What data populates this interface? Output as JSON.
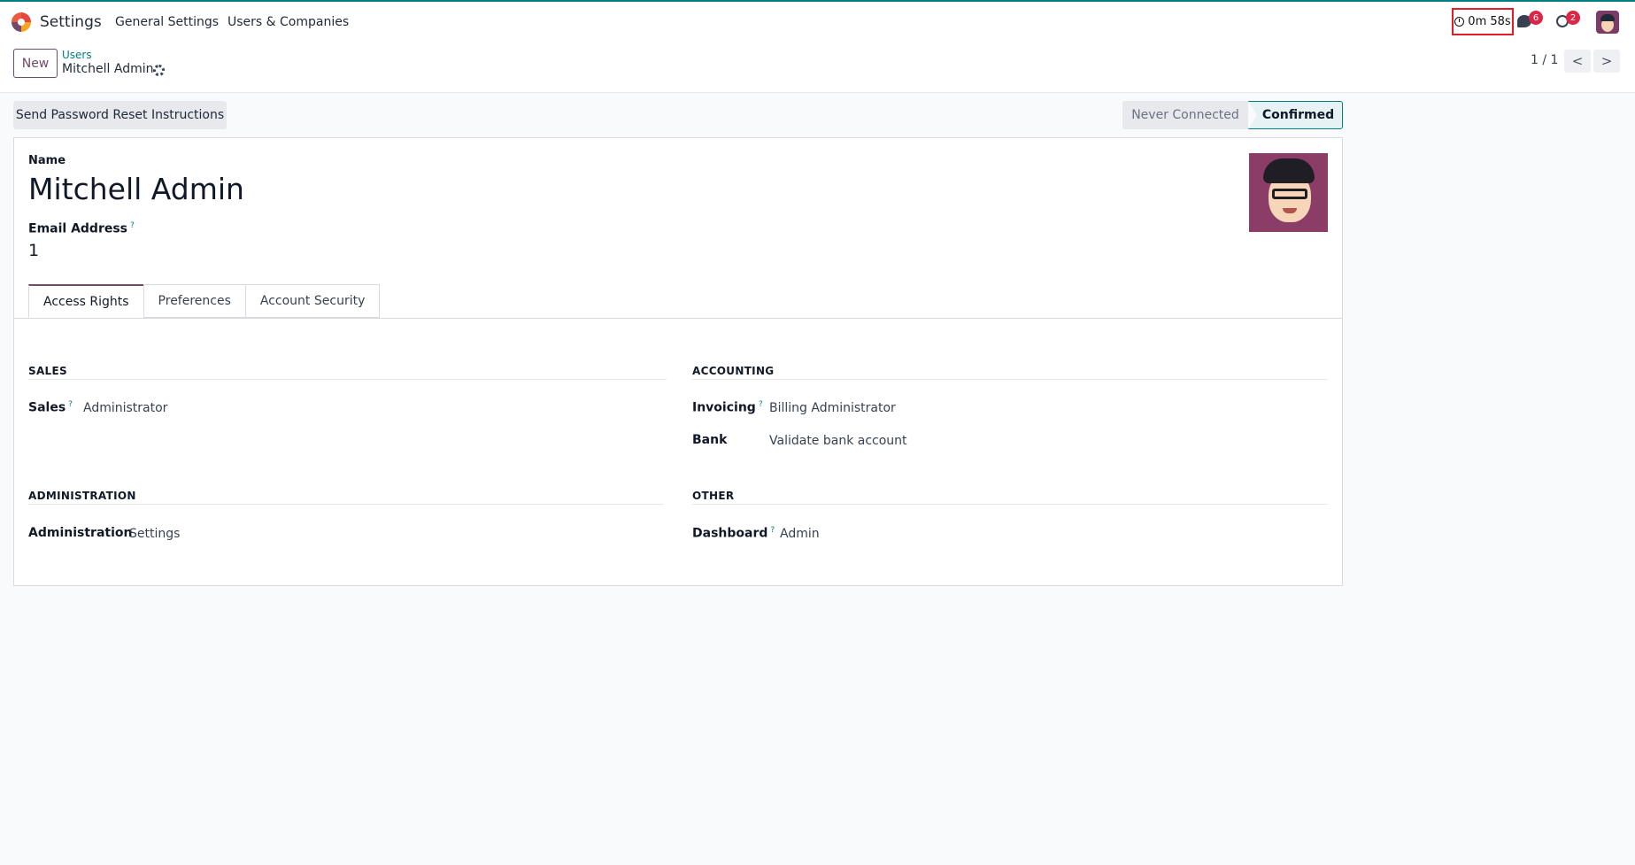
{
  "topbar": {
    "app_title": "Settings",
    "menu": [
      "General Settings",
      "Users & Companies"
    ],
    "timer": "0m 58s",
    "chat_badge": "6",
    "activity_badge": "2"
  },
  "control": {
    "new_label": "New",
    "breadcrumb_parent": "Users",
    "breadcrumb_current": "Mitchell Admin",
    "pager": "1 / 1",
    "prev": "<",
    "next": ">"
  },
  "actions": {
    "reset_label": "Send Password Reset Instructions",
    "status_never": "Never Connected",
    "status_confirmed": "Confirmed"
  },
  "form": {
    "name_label": "Name",
    "name_value": "Mitchell Admin",
    "email_label": "Email Address",
    "help": "?",
    "email_value": "1"
  },
  "tabs": [
    "Access Rights",
    "Preferences",
    "Account Security"
  ],
  "groups": {
    "sales": {
      "title": "SALES",
      "field_label": "Sales",
      "field_value": "Administrator"
    },
    "accounting": {
      "title": "ACCOUNTING",
      "invoicing_label": "Invoicing",
      "invoicing_value": "Billing Administrator",
      "bank_label": "Bank",
      "bank_value": "Validate bank account"
    },
    "administration": {
      "title": "ADMINISTRATION",
      "field_label": "Administration",
      "field_value": "Settings"
    },
    "other": {
      "title": "OTHER",
      "field_label": "Dashboard",
      "field_value": "Admin"
    }
  },
  "colors": {
    "brand": "#714b67",
    "accent": "#017e84",
    "badge": "#dc2646",
    "highlight_border": "#e11d2a"
  }
}
